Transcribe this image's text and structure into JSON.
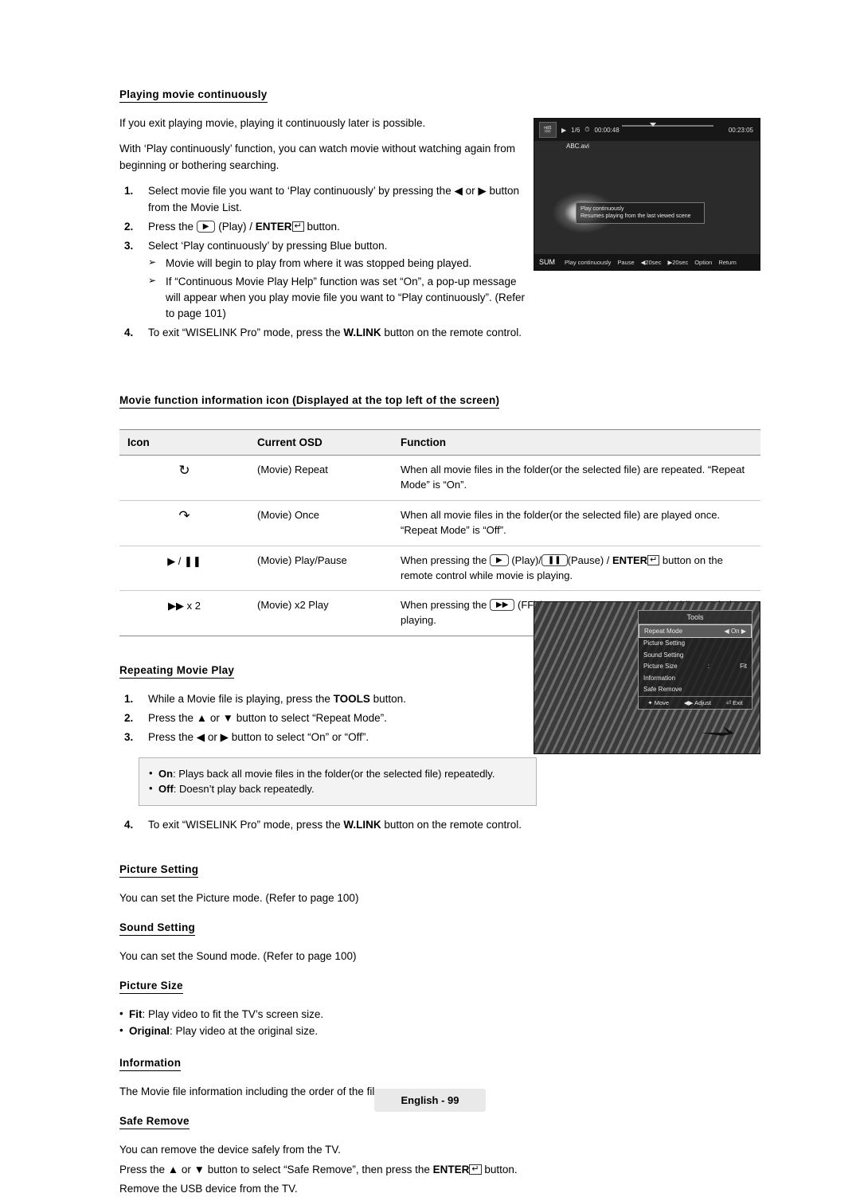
{
  "section1": {
    "heading": "Playing movie continuously",
    "intro1": "If you exit playing movie, playing it continuously later is possible.",
    "intro2": "With ‘Play continuously’ function, you can watch movie without watching again from beginning or bothering searching.",
    "steps": [
      {
        "num": "1.",
        "text_a": "Select movie file you want to ‘Play continuously’ by pressing the ",
        "text_b": " or ",
        "text_c": " button from the Movie List."
      },
      {
        "num": "2.",
        "text_a": "Press the ",
        "key": "▶",
        "text_b": " (Play) / ",
        "bold": "ENTER",
        "text_c": " button."
      },
      {
        "num": "3.",
        "text_a": "Select ‘Play continuously’ by pressing Blue button."
      },
      {
        "num": "4.",
        "text_a": "To exit “WISELINK Pro” mode, press the ",
        "bold": "W.LINK",
        "text_b": " button on the remote control."
      }
    ],
    "substeps": [
      "Movie will begin to play from where it was stopped being played.",
      "If “Continuous Movie Play Help” function was set “On”, a pop-up message will appear when you play movie file you want to “Play continuously”. (Refer to page 101)"
    ]
  },
  "tv_screenshot": {
    "name": "movie-playback-screen",
    "index": "1/6",
    "elapsed": "00:00:48",
    "total": "00:23:05",
    "filename": "ABC.avi",
    "popup_title": "Play continuously",
    "popup_body": "Resumes playing from the last viewed scene",
    "source_label": "SUM",
    "buttons": [
      "Play continuously",
      "Pause",
      "◀20sec",
      "▶20sec",
      "Option",
      "Return"
    ]
  },
  "section2": {
    "heading": "Movie function information icon (Displayed at the top left of the screen)",
    "table": {
      "headers": [
        "Icon",
        "Current OSD",
        "Function"
      ],
      "rows": [
        {
          "icon": "repeat-icon",
          "glyph": "↻",
          "osd": "(Movie) Repeat",
          "function": "When all movie files in the folder(or the selected file) are repeated. “Repeat Mode” is “On”."
        },
        {
          "icon": "once-icon",
          "glyph": "↷",
          "osd": "(Movie) Once",
          "function": "When all movie files in the folder(or the selected file) are played once. “Repeat Mode” is “Off”."
        },
        {
          "icon": "play-pause-icon",
          "glyph": "▶ / ❚❚",
          "osd": "(Movie) Play/Pause",
          "function_a": "When pressing the ",
          "function_key1": "▶",
          "function_b": " (Play)/",
          "function_key2": "❚❚",
          "function_c": "(Pause) / ",
          "function_bold": "ENTER",
          "function_d": " button on the remote control while movie is playing."
        },
        {
          "icon": "x2-play-icon",
          "glyph": "▶▶ x 2",
          "osd": "(Movie) x2 Play",
          "function_a": "When pressing the ",
          "function_key1": "▶▶",
          "function_b": " (FF) button on the remote control while movie is playing."
        }
      ]
    }
  },
  "section3": {
    "heading": "Repeating Movie Play",
    "steps": [
      {
        "num": "1.",
        "text_a": "While a Movie file is playing, press the ",
        "bold": "TOOLS",
        "text_b": " button."
      },
      {
        "num": "2.",
        "text_a": "Press the ▲ or ▼ button to select “Repeat Mode”."
      },
      {
        "num": "3.",
        "text_a": "Press the ◀ or ▶ button to select “On” or “Off”."
      },
      {
        "num": "4.",
        "text_a": "To exit “WISELINK Pro” mode, press the ",
        "bold": "W.LINK",
        "text_b": " button on the remote control."
      }
    ],
    "tips": [
      {
        "bold": "On",
        "text": ": Plays back all movie files in the folder(or the selected file) repeatedly."
      },
      {
        "bold": "Off",
        "text": ": Doesn’t play back repeatedly."
      }
    ]
  },
  "tools_screenshot": {
    "name": "tools-menu-screen",
    "title": "Tools",
    "items": [
      {
        "label": "Repeat Mode",
        "value": "On",
        "selected": true,
        "left_arrow": "◀",
        "right_arrow": "▶"
      },
      {
        "label": "Picture Setting",
        "value": "",
        "selected": false
      },
      {
        "label": "Sound Setting",
        "value": "",
        "selected": false
      },
      {
        "label": "Picture Size",
        "value": "Fit",
        "sep": ":",
        "selected": false
      },
      {
        "label": "Information",
        "value": "",
        "selected": false
      },
      {
        "label": "Safe Remove",
        "value": "",
        "selected": false
      }
    ],
    "footer": [
      "Move",
      "Adjust",
      "Exit"
    ]
  },
  "section4": {
    "heading": "Picture Setting",
    "text": "You can set the Picture mode. (Refer to page 100)"
  },
  "section5": {
    "heading": "Sound Setting",
    "text": "You can set the Sound mode. (Refer to page 100)"
  },
  "section6": {
    "heading": "Picture Size",
    "bullets": [
      {
        "bold": "Fit",
        "text": ": Play video to fit the TV’s screen size."
      },
      {
        "bold": "Original",
        "text": ": Play video at the original size."
      }
    ]
  },
  "section7": {
    "heading": "Information",
    "text": "The Movie file information including the order of the file."
  },
  "section8": {
    "heading": "Safe Remove",
    "text1": "You can remove the device safely from the TV.",
    "text2_a": "Press the ▲ or ▼ button to select “Safe Remove”, then press the ",
    "text2_bold": "ENTER",
    "text2_b": " button.",
    "text3": "Remove the USB device from the TV."
  },
  "footer": {
    "page_label": "English - 99"
  }
}
